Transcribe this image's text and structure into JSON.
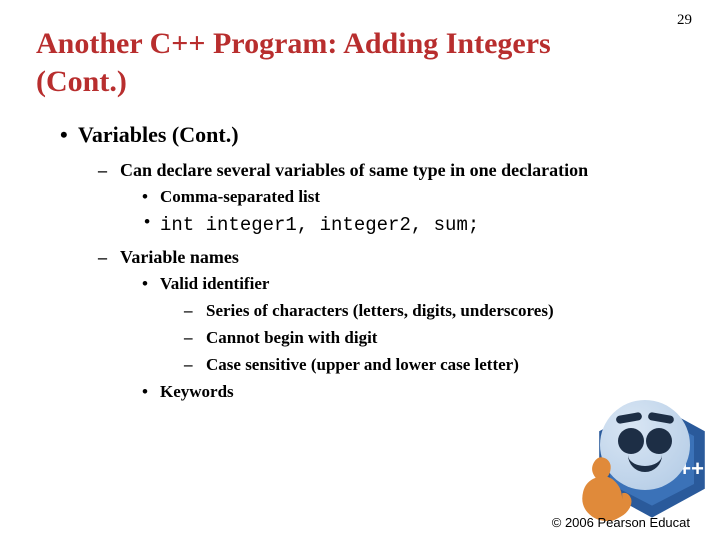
{
  "pageNumber": "29",
  "title": "Another C++ Program: Adding Integers (Cont.)",
  "bullets": {
    "l1_1": "Variables (Cont.)",
    "l2_1": "Can declare several variables of same type in one declaration",
    "l3_1": "Comma-separated list",
    "l3_2": "int integer1, integer2, sum;",
    "l2_2": "Variable names",
    "l3_3": "Valid identifier",
    "l4_1": "Series of characters (letters, digits, underscores)",
    "l4_2": "Cannot begin with digit",
    "l4_3": "Case sensitive (upper and lower case letter)",
    "l3_4": "Keywords"
  },
  "footer": "© 2006 Pearson Educat",
  "logo": {
    "plusplus": "++"
  }
}
